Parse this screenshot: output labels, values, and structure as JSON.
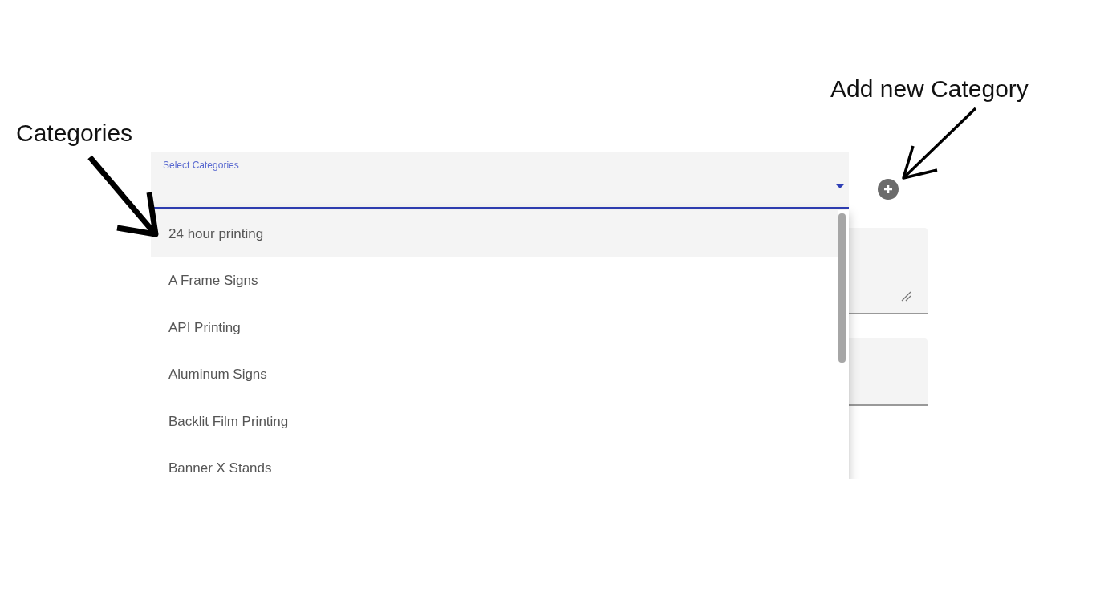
{
  "annotations": [
    {
      "text": "Categories"
    },
    {
      "text": "Add new Category"
    }
  ],
  "select": {
    "label": "Select Categories",
    "expanded": true
  },
  "options": [
    {
      "label": "24 hour printing",
      "selected": true
    },
    {
      "label": "A Frame Signs",
      "selected": false
    },
    {
      "label": "API Printing",
      "selected": false
    },
    {
      "label": "Aluminum Signs",
      "selected": false
    },
    {
      "label": "Backlit Film Printing",
      "selected": false
    },
    {
      "label": "Banner X Stands",
      "selected": false
    }
  ]
}
